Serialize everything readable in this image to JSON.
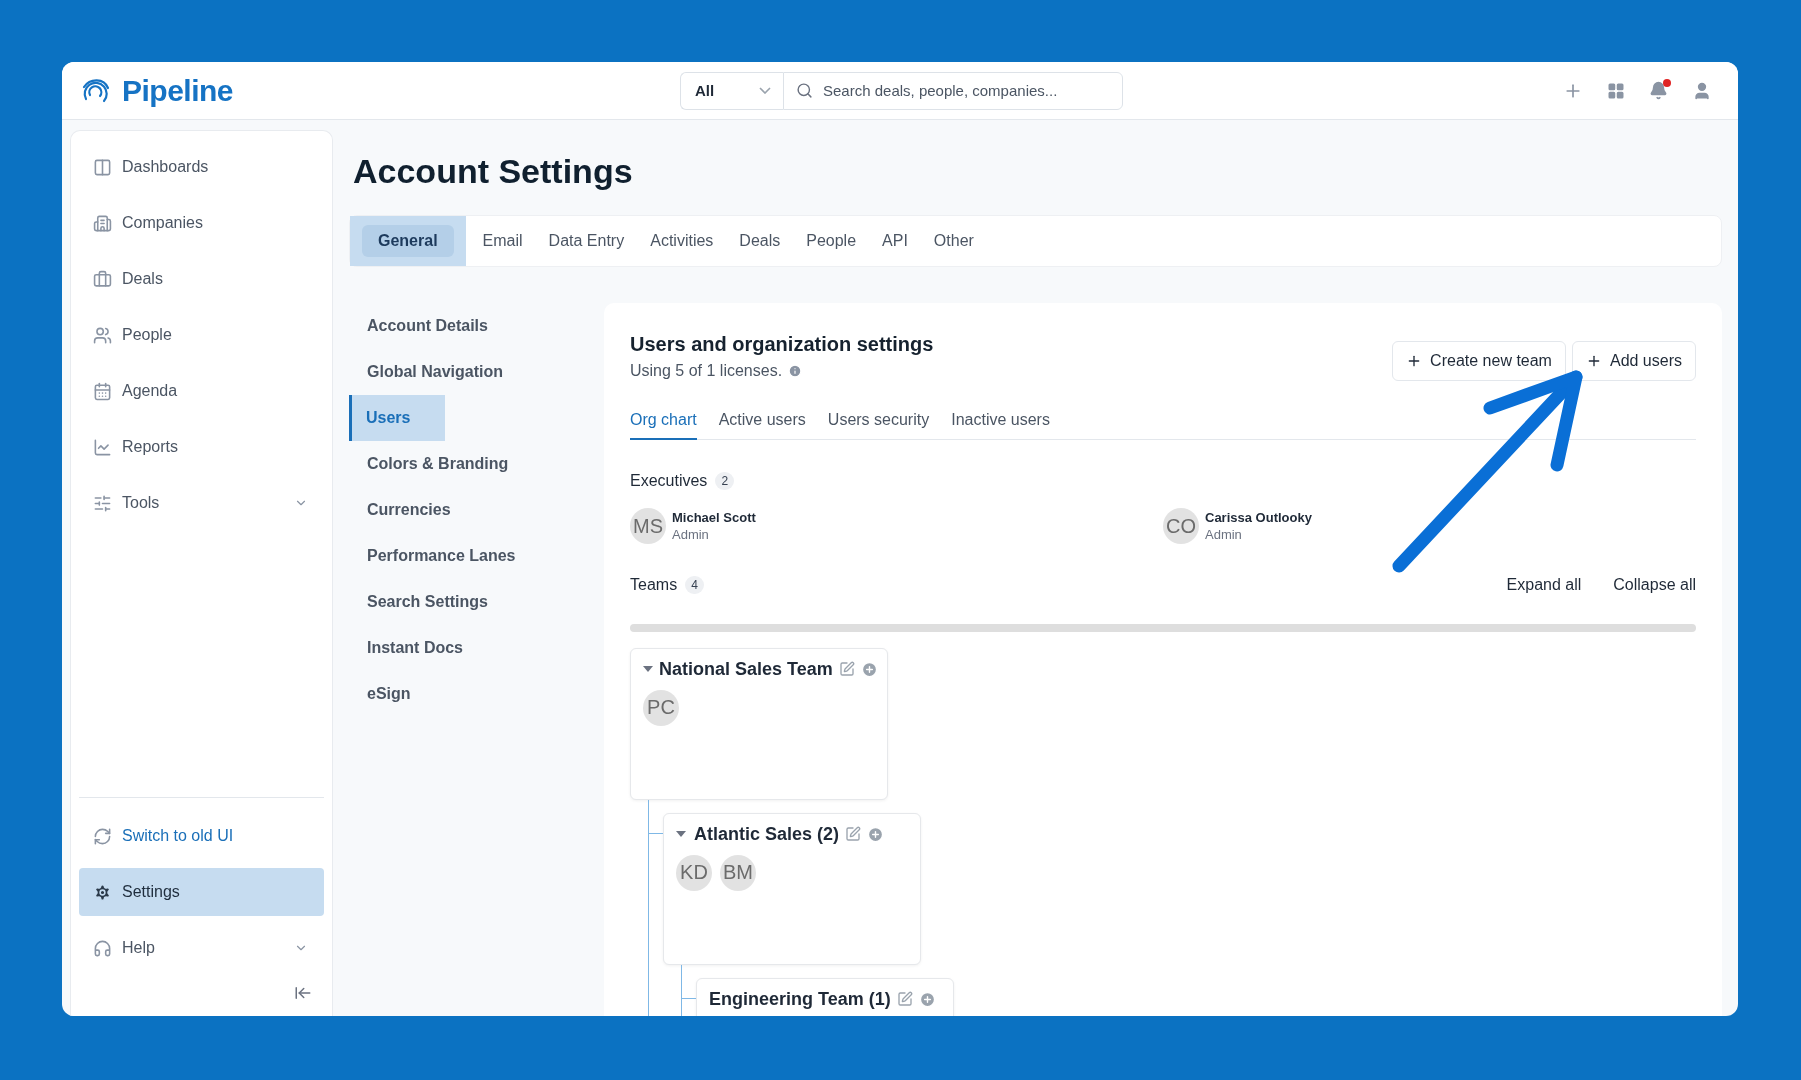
{
  "app": {
    "name": "Pipeline"
  },
  "header": {
    "scope": {
      "value": "All"
    },
    "search": {
      "placeholder": "Search deals, people, companies..."
    },
    "notifications": {
      "unread": true
    }
  },
  "sidebar": {
    "items": [
      {
        "label": "Dashboards",
        "selected": false
      },
      {
        "label": "Companies",
        "selected": false
      },
      {
        "label": "Deals",
        "selected": false
      },
      {
        "label": "People",
        "selected": false
      },
      {
        "label": "Agenda",
        "selected": false
      },
      {
        "label": "Reports",
        "selected": false
      },
      {
        "label": "Tools",
        "selected": false,
        "expanded": false
      }
    ],
    "footer_items": [
      {
        "kind": "link",
        "label": "Switch to old UI",
        "selected": false
      },
      {
        "kind": "item",
        "label": "Settings",
        "selected": true
      },
      {
        "kind": "item",
        "label": "Help",
        "selected": false,
        "expanded": false
      }
    ]
  },
  "page": {
    "title": "Account Settings"
  },
  "settings_tabs": [
    {
      "label": "General",
      "selected": true
    },
    {
      "label": "Email",
      "selected": false
    },
    {
      "label": "Data Entry",
      "selected": false
    },
    {
      "label": "Activities",
      "selected": false
    },
    {
      "label": "Deals",
      "selected": false
    },
    {
      "label": "People",
      "selected": false
    },
    {
      "label": "API",
      "selected": false
    },
    {
      "label": "Other",
      "selected": false
    }
  ],
  "settings_nav": [
    {
      "label": "Account Details",
      "selected": false
    },
    {
      "label": "Global Navigation",
      "selected": false
    },
    {
      "label": "Users",
      "selected": true
    },
    {
      "label": "Colors & Branding",
      "selected": false
    },
    {
      "label": "Currencies",
      "selected": false
    },
    {
      "label": "Performance Lanes",
      "selected": false
    },
    {
      "label": "Search Settings",
      "selected": false
    },
    {
      "label": "Instant Docs",
      "selected": false
    },
    {
      "label": "eSign",
      "selected": false
    }
  ],
  "panel": {
    "title": "Users and organization settings",
    "subtitle": "Using 5 of 1 licenses.",
    "actions": [
      "Create new team",
      "Add users"
    ],
    "tabs": [
      {
        "label": "Org chart",
        "selected": true
      },
      {
        "label": "Active users",
        "selected": false
      },
      {
        "label": "Users security",
        "selected": false
      },
      {
        "label": "Inactive users",
        "selected": false
      }
    ],
    "executives": {
      "label": "Executives",
      "count": "2",
      "people": [
        {
          "initials": "MS",
          "name": "Michael Scott",
          "role": "Admin"
        },
        {
          "initials": "CO",
          "name": "Carissa Outlooky",
          "role": "Admin"
        }
      ]
    },
    "teams": {
      "label": "Teams",
      "count": "4",
      "actions": [
        "Expand all",
        "Collapse all"
      ],
      "tree": [
        {
          "name": "National Sales Team",
          "expanded": true,
          "members": [
            "PC"
          ],
          "children": [
            {
              "name": "Atlantic Sales (2)",
              "expanded": true,
              "members": [
                "KD",
                "BM"
              ],
              "children": [
                {
                  "name": "Engineering Team (1)"
                }
              ]
            }
          ]
        }
      ]
    }
  }
}
